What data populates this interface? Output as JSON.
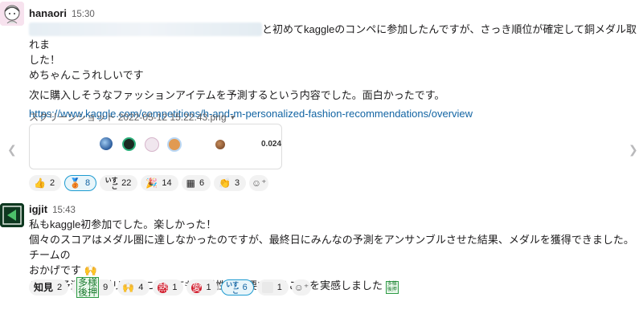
{
  "messages": [
    {
      "author": "hanaori",
      "time": "15:30",
      "line1": "と初めてkaggleのコンペに参加したんですが、さっき順位が確定して銅メダル取れま",
      "line2": "した！",
      "line3": "めちゃんこうれしいです",
      "line4": "次に購入しそうなファッションアイテムを予測するという内容でした。面白かったです。",
      "link": "https://www.kaggle.com/competitions/h-and-m-personalized-fashion-recommendations/overview",
      "file_name": "スクリーンショット 2022-05-12 15.22.43.png",
      "preview_score": "0.024",
      "reactions": [
        {
          "icon": "thumbs-up-icon",
          "glyph": "👍",
          "count": "2",
          "active": false
        },
        {
          "icon": "bronze-medal-icon",
          "glyph": "🥉",
          "count": "8",
          "active": true
        },
        {
          "icon": "sugoi-stamp-icon",
          "glyph": "すごい",
          "count": "22",
          "active": false
        },
        {
          "icon": "party-popper-icon",
          "glyph": "🎉",
          "count": "14",
          "active": false
        },
        {
          "icon": "grid-stamp-icon",
          "glyph": "▦",
          "count": "6",
          "active": false
        },
        {
          "icon": "clapping-hands-icon",
          "glyph": "👏",
          "count": "3",
          "active": false
        }
      ]
    },
    {
      "author": "igjit",
      "time": "15:43",
      "line1": "私もkaggle初参加でした。楽しかった！",
      "line2": "個々のスコアはメダル圏に達しなかったのですが、最終日にみんなの予測をアンサンブルさせた結果、メダルを獲得できました。チームの",
      "line3": "おかげです",
      "line3_emoji": "🙌",
      "line4": "そして予測アルゴリズムにおいても多様性が重要であることを実感しました",
      "line4_badge": "多様\n後押",
      "reactions": [
        {
          "icon": "kanji-stamp-icon",
          "glyph": "知見",
          "count": "2",
          "active": false
        },
        {
          "icon": "green-badge-icon",
          "glyph": "多様\n後押",
          "count": "9",
          "active": false
        },
        {
          "icon": "raised-hands-icon",
          "glyph": "🙌",
          "count": "4",
          "active": false
        },
        {
          "icon": "red-circle-icon",
          "glyph": "熱",
          "count": "1",
          "active": false
        },
        {
          "icon": "red-circle-love-icon",
          "glyph": "愛",
          "count": "1",
          "active": false
        },
        {
          "icon": "sugoi-stamp-icon",
          "glyph": "すごい",
          "count": "6",
          "active": true
        },
        {
          "icon": "blank-stamp-icon",
          "glyph": "",
          "count": "1",
          "active": false
        }
      ]
    }
  ]
}
